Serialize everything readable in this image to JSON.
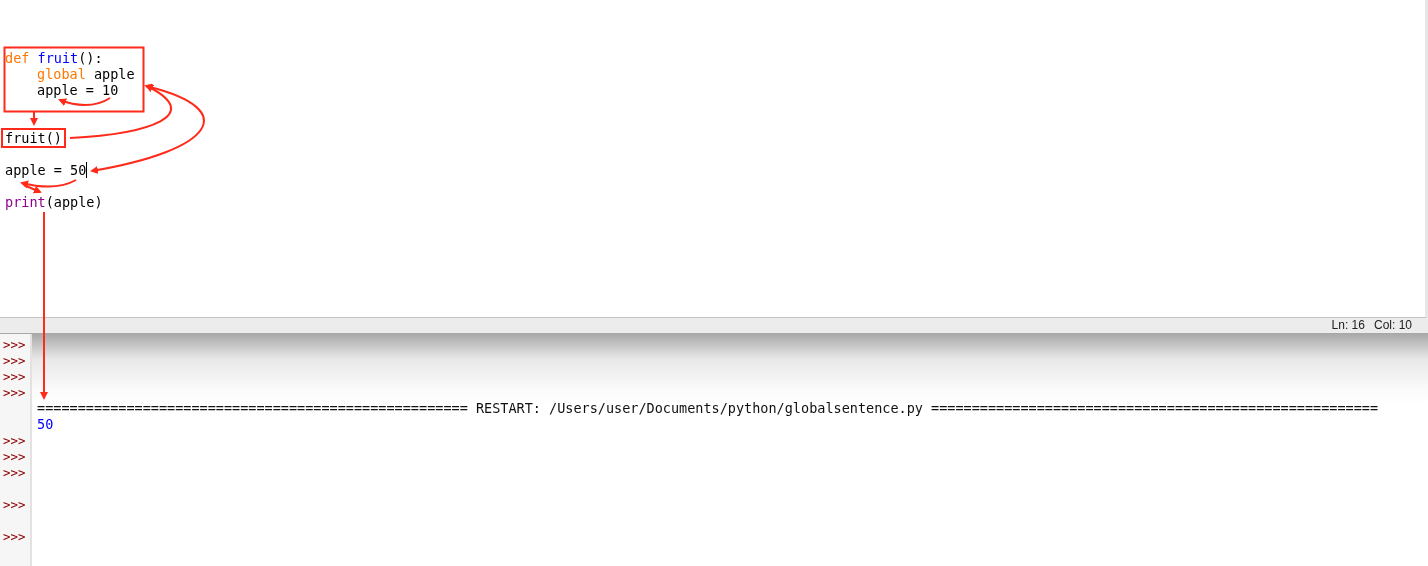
{
  "editor": {
    "lines": [
      {
        "cursor": false,
        "tokens": [
          {
            "kind": "keyword",
            "text": "def"
          },
          {
            "kind": "defname",
            "text": " fruit"
          },
          {
            "kind": "plain",
            "text": "():"
          }
        ],
        "children": [
          {
            "cursor": false,
            "tokens": [
              {
                "kind": "keyword",
                "text": "global"
              },
              {
                "kind": "plain",
                "text": " apple"
              }
            ]
          },
          {
            "cursor": false,
            "tokens": [
              {
                "kind": "plain",
                "text": "apple = 10"
              }
            ]
          }
        ]
      },
      {
        "cursor": false
      },
      {
        "cursor": false
      },
      {
        "cursor": false,
        "tokens": [
          {
            "kind": "plain",
            "text": "fruit()"
          }
        ]
      },
      {
        "cursor": false
      },
      {
        "cursor": true,
        "tokens": [
          {
            "kind": "plain",
            "text": "apple = 50"
          }
        ]
      },
      {
        "cursor": false
      },
      {
        "cursor": false,
        "tokens": [
          {
            "kind": "builtin",
            "text": "print"
          },
          {
            "kind": "plain",
            "text": "(apple)"
          }
        ]
      }
    ]
  },
  "status_bar": {
    "line": "Ln: 16",
    "column": "Col: 10"
  },
  "shell": {
    "rows": [
      {
        "prompt": ">>>",
        "kind": "input"
      },
      {
        "prompt": ">>>",
        "kind": "input"
      },
      {
        "prompt": ">>>",
        "kind": "input"
      },
      {
        "prompt": ">>>",
        "kind": "input"
      },
      {
        "kind": "restart",
        "text": "===================================================== RESTART: /Users/user/Documents/python/globalsentence.py ======================================================="
      },
      {
        "kind": "output",
        "text": "50"
      },
      {
        "prompt": ">>>",
        "kind": "input"
      },
      {
        "prompt": ">>>",
        "kind": "input"
      },
      {
        "prompt": ">>>",
        "kind": "input"
      },
      {
        "kind": "input"
      },
      {
        "prompt": ">>>",
        "kind": "input"
      },
      {
        "kind": "input"
      },
      {
        "prompt": ">>>",
        "kind": "input"
      }
    ]
  }
}
